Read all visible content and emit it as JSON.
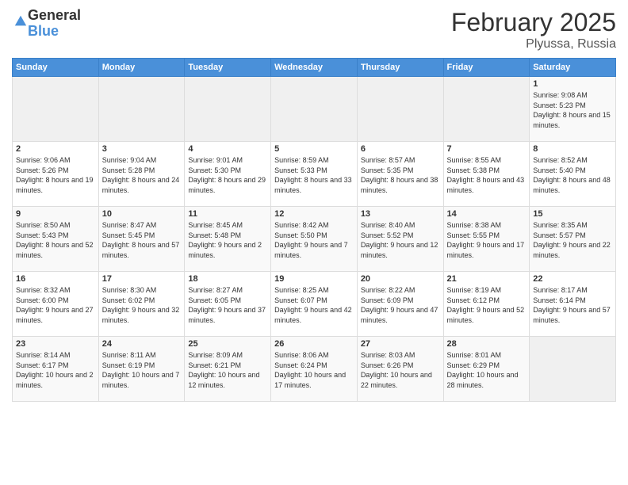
{
  "logo": {
    "general": "General",
    "blue": "Blue"
  },
  "header": {
    "month_year": "February 2025",
    "location": "Plyussa, Russia"
  },
  "weekdays": [
    "Sunday",
    "Monday",
    "Tuesday",
    "Wednesday",
    "Thursday",
    "Friday",
    "Saturday"
  ],
  "weeks": [
    [
      {
        "day": "",
        "info": ""
      },
      {
        "day": "",
        "info": ""
      },
      {
        "day": "",
        "info": ""
      },
      {
        "day": "",
        "info": ""
      },
      {
        "day": "",
        "info": ""
      },
      {
        "day": "",
        "info": ""
      },
      {
        "day": "1",
        "info": "Sunrise: 9:08 AM\nSunset: 5:23 PM\nDaylight: 8 hours and 15 minutes."
      }
    ],
    [
      {
        "day": "2",
        "info": "Sunrise: 9:06 AM\nSunset: 5:26 PM\nDaylight: 8 hours and 19 minutes."
      },
      {
        "day": "3",
        "info": "Sunrise: 9:04 AM\nSunset: 5:28 PM\nDaylight: 8 hours and 24 minutes."
      },
      {
        "day": "4",
        "info": "Sunrise: 9:01 AM\nSunset: 5:30 PM\nDaylight: 8 hours and 29 minutes."
      },
      {
        "day": "5",
        "info": "Sunrise: 8:59 AM\nSunset: 5:33 PM\nDaylight: 8 hours and 33 minutes."
      },
      {
        "day": "6",
        "info": "Sunrise: 8:57 AM\nSunset: 5:35 PM\nDaylight: 8 hours and 38 minutes."
      },
      {
        "day": "7",
        "info": "Sunrise: 8:55 AM\nSunset: 5:38 PM\nDaylight: 8 hours and 43 minutes."
      },
      {
        "day": "8",
        "info": "Sunrise: 8:52 AM\nSunset: 5:40 PM\nDaylight: 8 hours and 48 minutes."
      }
    ],
    [
      {
        "day": "9",
        "info": "Sunrise: 8:50 AM\nSunset: 5:43 PM\nDaylight: 8 hours and 52 minutes."
      },
      {
        "day": "10",
        "info": "Sunrise: 8:47 AM\nSunset: 5:45 PM\nDaylight: 8 hours and 57 minutes."
      },
      {
        "day": "11",
        "info": "Sunrise: 8:45 AM\nSunset: 5:48 PM\nDaylight: 9 hours and 2 minutes."
      },
      {
        "day": "12",
        "info": "Sunrise: 8:42 AM\nSunset: 5:50 PM\nDaylight: 9 hours and 7 minutes."
      },
      {
        "day": "13",
        "info": "Sunrise: 8:40 AM\nSunset: 5:52 PM\nDaylight: 9 hours and 12 minutes."
      },
      {
        "day": "14",
        "info": "Sunrise: 8:38 AM\nSunset: 5:55 PM\nDaylight: 9 hours and 17 minutes."
      },
      {
        "day": "15",
        "info": "Sunrise: 8:35 AM\nSunset: 5:57 PM\nDaylight: 9 hours and 22 minutes."
      }
    ],
    [
      {
        "day": "16",
        "info": "Sunrise: 8:32 AM\nSunset: 6:00 PM\nDaylight: 9 hours and 27 minutes."
      },
      {
        "day": "17",
        "info": "Sunrise: 8:30 AM\nSunset: 6:02 PM\nDaylight: 9 hours and 32 minutes."
      },
      {
        "day": "18",
        "info": "Sunrise: 8:27 AM\nSunset: 6:05 PM\nDaylight: 9 hours and 37 minutes."
      },
      {
        "day": "19",
        "info": "Sunrise: 8:25 AM\nSunset: 6:07 PM\nDaylight: 9 hours and 42 minutes."
      },
      {
        "day": "20",
        "info": "Sunrise: 8:22 AM\nSunset: 6:09 PM\nDaylight: 9 hours and 47 minutes."
      },
      {
        "day": "21",
        "info": "Sunrise: 8:19 AM\nSunset: 6:12 PM\nDaylight: 9 hours and 52 minutes."
      },
      {
        "day": "22",
        "info": "Sunrise: 8:17 AM\nSunset: 6:14 PM\nDaylight: 9 hours and 57 minutes."
      }
    ],
    [
      {
        "day": "23",
        "info": "Sunrise: 8:14 AM\nSunset: 6:17 PM\nDaylight: 10 hours and 2 minutes."
      },
      {
        "day": "24",
        "info": "Sunrise: 8:11 AM\nSunset: 6:19 PM\nDaylight: 10 hours and 7 minutes."
      },
      {
        "day": "25",
        "info": "Sunrise: 8:09 AM\nSunset: 6:21 PM\nDaylight: 10 hours and 12 minutes."
      },
      {
        "day": "26",
        "info": "Sunrise: 8:06 AM\nSunset: 6:24 PM\nDaylight: 10 hours and 17 minutes."
      },
      {
        "day": "27",
        "info": "Sunrise: 8:03 AM\nSunset: 6:26 PM\nDaylight: 10 hours and 22 minutes."
      },
      {
        "day": "28",
        "info": "Sunrise: 8:01 AM\nSunset: 6:29 PM\nDaylight: 10 hours and 28 minutes."
      },
      {
        "day": "",
        "info": ""
      }
    ]
  ]
}
